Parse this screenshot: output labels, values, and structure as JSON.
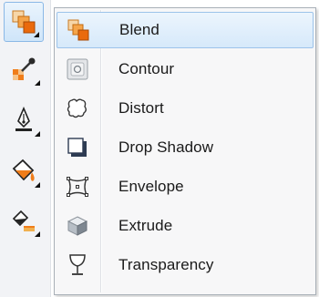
{
  "toolbar": {
    "tools": [
      {
        "name": "blend-tool",
        "icon": "blend-icon",
        "active": true
      },
      {
        "name": "eyedropper-tool",
        "icon": "eyedropper-icon",
        "active": false
      },
      {
        "name": "pen-outline-tool",
        "icon": "pen-nib-icon",
        "active": false
      },
      {
        "name": "fill-tool",
        "icon": "paint-bucket-icon",
        "active": false
      },
      {
        "name": "interactive-fill-tool",
        "icon": "interactive-fill-icon",
        "active": false
      }
    ]
  },
  "menu": {
    "items": [
      {
        "label": "Blend",
        "icon": "blend-icon",
        "highlighted": true
      },
      {
        "label": "Contour",
        "icon": "contour-icon",
        "highlighted": false
      },
      {
        "label": "Distort",
        "icon": "distort-icon",
        "highlighted": false
      },
      {
        "label": "Drop Shadow",
        "icon": "drop-shadow-icon",
        "highlighted": false
      },
      {
        "label": "Envelope",
        "icon": "envelope-icon",
        "highlighted": false
      },
      {
        "label": "Extrude",
        "icon": "extrude-icon",
        "highlighted": false
      },
      {
        "label": "Transparency",
        "icon": "transparency-icon",
        "highlighted": false
      }
    ]
  },
  "colors": {
    "accent": "#f07d1a",
    "highlight": "#d6e9fa",
    "highlight_border": "#9cc3ea"
  }
}
